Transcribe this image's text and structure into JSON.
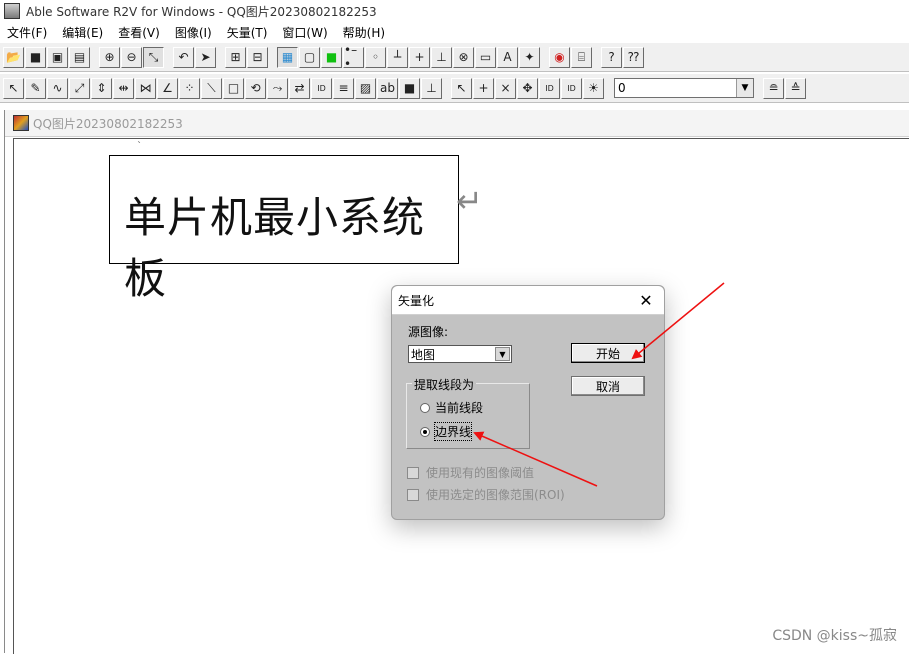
{
  "window": {
    "title": "Able Software R2V for Windows - QQ图片20230802182253"
  },
  "menu": [
    "文件(F)",
    "编辑(E)",
    "查看(V)",
    "图像(I)",
    "矢量(T)",
    "窗口(W)",
    "帮助(H)"
  ],
  "toolbar1": {
    "groups": [
      [
        "open-folder-icon",
        "save-icon",
        "open-image-icon",
        "save-image-icon"
      ],
      [
        "zoom-in-icon",
        "zoom-out-icon",
        "zoom-fit-icon"
      ],
      [
        "undo-icon",
        "select-arrow-icon"
      ],
      [
        "raster-grid-icon",
        "vector-grid-icon"
      ],
      [
        "image-map-icon",
        "frame-icon",
        "green-fill-icon",
        "line-node-icon",
        "node-icon",
        "vertex-icon",
        "crosshair-icon",
        "snap-icon",
        "delete-node-icon",
        "abc-box-icon",
        "abc-text-icon",
        "point-icon"
      ],
      [
        "pick-color-icon",
        "edit-box-icon"
      ],
      [
        "help-icon",
        "context-help-icon"
      ]
    ],
    "glyphs": {
      "open-folder-icon": "📂",
      "save-icon": "■",
      "open-image-icon": "▣",
      "save-image-icon": "▤",
      "zoom-in-icon": "⊕",
      "zoom-out-icon": "⊖",
      "zoom-fit-icon": "⤡",
      "undo-icon": "↶",
      "select-arrow-icon": "➤",
      "raster-grid-icon": "⊞",
      "vector-grid-icon": "⊟",
      "image-map-icon": "▦",
      "frame-icon": "▢",
      "green-fill-icon": "■",
      "line-node-icon": "•–•",
      "node-icon": "◦",
      "vertex-icon": "┴",
      "crosshair-icon": "+",
      "snap-icon": "⊥",
      "delete-node-icon": "⊗",
      "abc-box-icon": "▭",
      "abc-text-icon": "A",
      "point-icon": "✦",
      "pick-color-icon": "◉",
      "edit-box-icon": "⌸",
      "help-icon": "?",
      "context-help-icon": "⁇"
    }
  },
  "toolbar2": {
    "icons": [
      "pointer-tool-icon",
      "pen-tool-icon",
      "curve-tool-icon",
      "trace-tool-icon",
      "move-up-icon",
      "split-icon",
      "join-icon",
      "angle-icon",
      "scatter-icon",
      "diagonal-icon",
      "rect-tool-icon",
      "rotate-icon",
      "connect-icon",
      "arrows-icon",
      "id-label-icon",
      "stack-icon",
      "hatch-icon",
      "text-box-icon",
      "fill-icon",
      "align-icon"
    ],
    "icons2": [
      "cursor-icon",
      "add-point-icon",
      "remove-point-icon",
      "move-point-icon",
      "id-set-icon",
      "id-mark-icon",
      "light-icon"
    ],
    "glyphs": {
      "pointer-tool-icon": "↖",
      "pen-tool-icon": "✎",
      "curve-tool-icon": "∿",
      "trace-tool-icon": "⤢",
      "move-up-icon": "⇕",
      "split-icon": "⇹",
      "join-icon": "⋈",
      "angle-icon": "∠",
      "scatter-icon": "⁘",
      "diagonal-icon": "⟍",
      "rect-tool-icon": "□",
      "rotate-icon": "⟲",
      "connect-icon": "⤳",
      "arrows-icon": "⇄",
      "id-label-icon": "ID",
      "stack-icon": "≡",
      "hatch-icon": "▨",
      "text-box-icon": "ab",
      "fill-icon": "■",
      "align-icon": "⊥",
      "cursor-icon": "↖",
      "add-point-icon": "+",
      "remove-point-icon": "×",
      "move-point-icon": "✥",
      "id-set-icon": "ID",
      "id-mark-icon": "ID",
      "light-icon": "☀",
      "layer-up-icon": "≘",
      "layer-down-icon": "≙"
    },
    "select_value": "0",
    "tail_icons": [
      "layer-up-icon",
      "layer-down-icon"
    ]
  },
  "document": {
    "title": "QQ图片20230802182253",
    "image_text": "单片机最小系统板",
    "return_mark": "↵"
  },
  "dialog": {
    "title": "矢量化",
    "close": "✕",
    "source_label": "源图像:",
    "source_value": "地图",
    "group_label": "提取线段为",
    "radio_current": "当前线段",
    "radio_boundary": "边界线",
    "start_button": "开始",
    "cancel_button": "取消",
    "check_threshold": "使用现有的图像阈值",
    "check_roi": "使用选定的图像范围(ROI)"
  },
  "colors": {
    "arrow": "#ee1111",
    "dialog_bg": "#c2c2c2"
  },
  "watermark": "CSDN @kiss~孤寂"
}
